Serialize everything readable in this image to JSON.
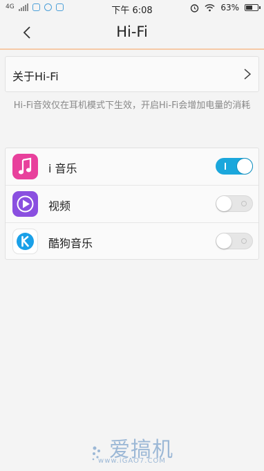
{
  "status_bar": {
    "network": "4G",
    "time": "下午 6:08",
    "battery": "63%",
    "battery_level": 0.63,
    "left_icons": [
      "signal-icon",
      "shield-check-icon",
      "check-circle-icon",
      "image-icon"
    ],
    "right_icons": [
      "alarm-icon",
      "wifi-icon",
      "battery-icon"
    ]
  },
  "header": {
    "title": "Hi-Fi",
    "back_icon": "chevron-left-icon"
  },
  "about": {
    "label": "关于Hi-Fi",
    "arrow_icon": "chevron-right-icon"
  },
  "description": "Hi-Fi音效仅在耳机模式下生效，开启Hi-Fi会增加电量的消耗",
  "apps": [
    {
      "name": "i 音乐",
      "icon": "music-note-icon",
      "icon_color": "#e8409c",
      "enabled": true
    },
    {
      "name": "视频",
      "icon": "play-icon",
      "icon_color": "#8a4fe0",
      "enabled": false
    },
    {
      "name": "酷狗音乐",
      "icon": "kugou-icon",
      "icon_color": "#1aa0e8",
      "enabled": false
    }
  ],
  "watermark": {
    "text": "爱搞机",
    "url": "www.iGAO7.COM"
  },
  "colors": {
    "accent": "#1ba7dc",
    "header_divider": "#f6c9a6",
    "background": "#f4f4f4"
  }
}
